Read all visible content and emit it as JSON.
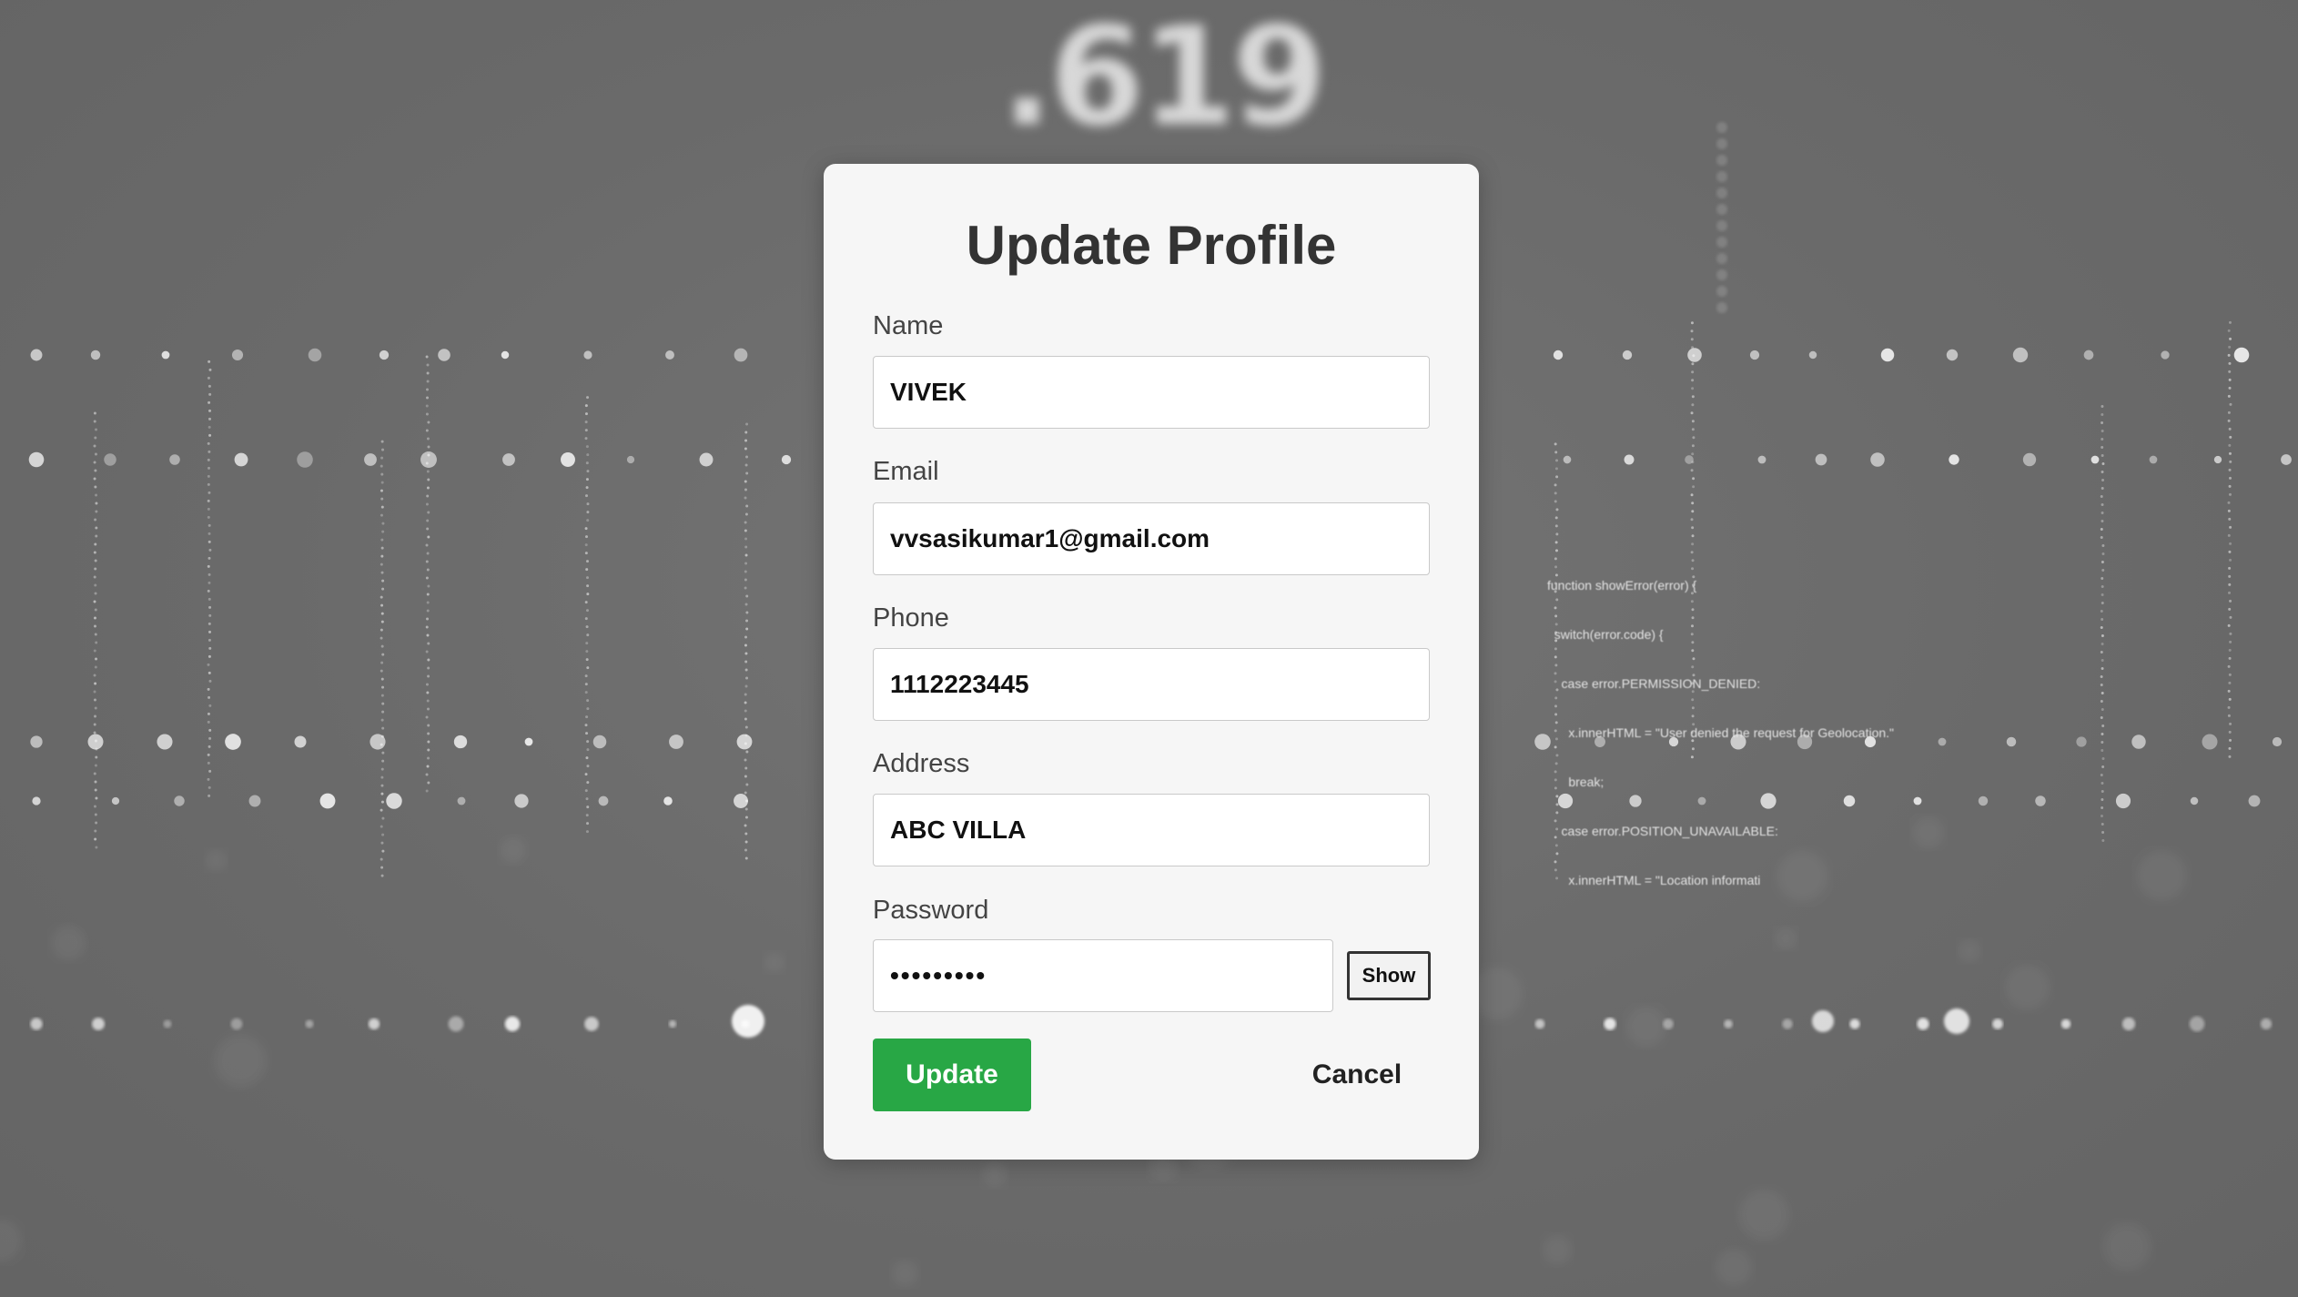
{
  "background": {
    "number_text": ".619",
    "code_lines": [
      "function showError(error) {",
      "  switch(error.code) {",
      "    case error.PERMISSION_DENIED:",
      "      x.innerHTML = \"User denied the request for Geolocation.\"",
      "      break;",
      "    case error.POSITION_UNAVAILABLE:",
      "      x.innerHTML = \"Location informati"
    ]
  },
  "form": {
    "title": "Update Profile",
    "fields": {
      "name": {
        "label": "Name",
        "value": "VIVEK"
      },
      "email": {
        "label": "Email",
        "value": "vvsasikumar1@gmail.com"
      },
      "phone": {
        "label": "Phone",
        "value": "1112223445"
      },
      "address": {
        "label": "Address",
        "value": "ABC VILLA"
      },
      "password": {
        "label": "Password",
        "value": "123456789",
        "input_type": "password"
      }
    },
    "show_label": "Show",
    "update_label": "Update",
    "cancel_label": "Cancel"
  },
  "colors": {
    "update_button": "#28a745",
    "card_background": "#f6f6f6",
    "page_background": "#6b6b6b"
  }
}
